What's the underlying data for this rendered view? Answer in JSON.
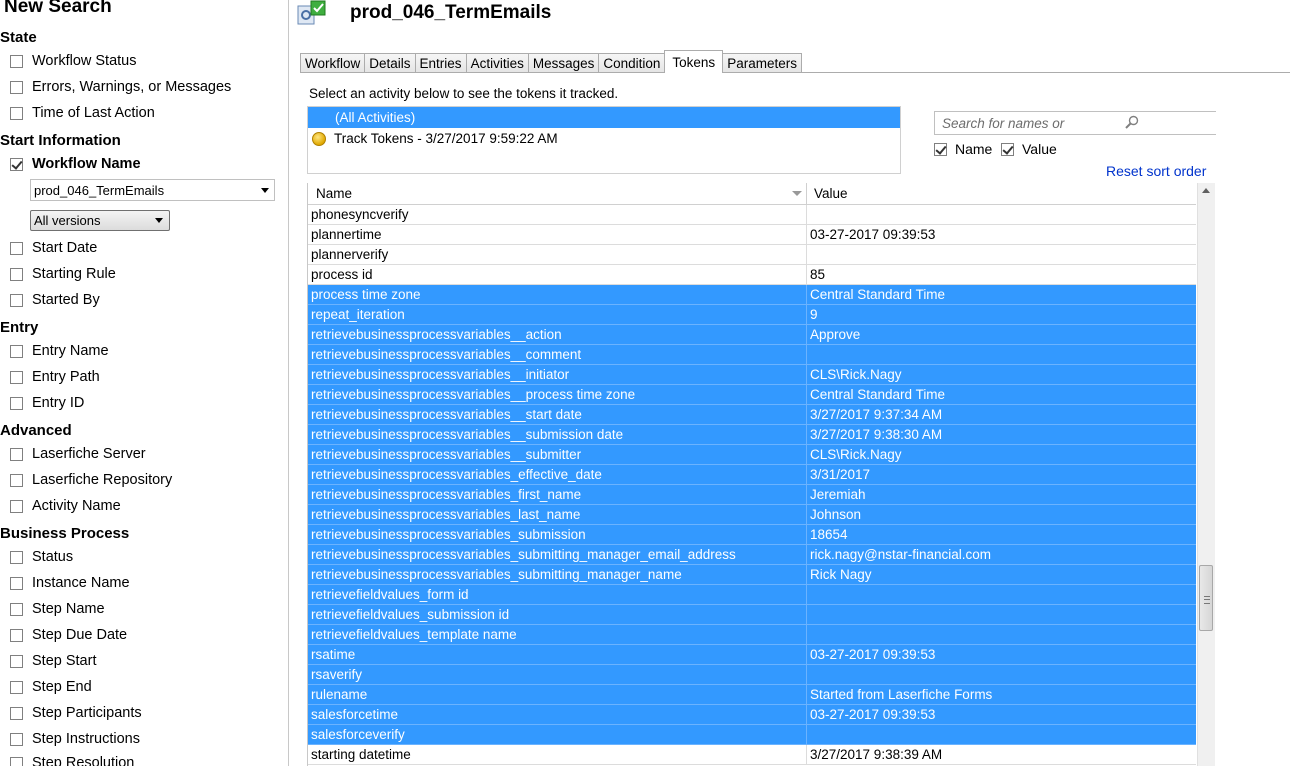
{
  "left_panel": {
    "title": "New Search",
    "sections": {
      "state": "State",
      "start_info": "Start Information",
      "entry": "Entry",
      "advanced": "Advanced",
      "business_process": "Business Process"
    },
    "options": {
      "workflow_status": "Workflow Status",
      "errors": "Errors, Warnings, or Messages",
      "time_last_action": "Time of Last Action",
      "workflow_name": "Workflow Name",
      "start_date": "Start Date",
      "starting_rule": "Starting Rule",
      "started_by": "Started By",
      "entry_name": "Entry Name",
      "entry_path": "Entry Path",
      "entry_id": "Entry ID",
      "lf_server": "Laserfiche Server",
      "lf_repository": "Laserfiche Repository",
      "activity_name": "Activity Name",
      "status": "Status",
      "instance_name": "Instance Name",
      "step_name": "Step Name",
      "step_due_date": "Step Due Date",
      "step_start": "Step Start",
      "step_end": "Step End",
      "step_participants": "Step Participants",
      "step_instructions": "Step Instructions",
      "step_resolution": "Step Resolution"
    },
    "workflow_name_value": "prod_046_TermEmails",
    "versions_value": "All versions"
  },
  "header": {
    "title": "prod_046_TermEmails"
  },
  "tabs": [
    "Workflow",
    "Details",
    "Entries",
    "Activities",
    "Messages",
    "Condition",
    "Tokens",
    "Parameters"
  ],
  "active_tab": "Tokens",
  "instruction": "Select an activity below to see the tokens it tracked.",
  "activities": [
    "(All Activities)",
    "Track Tokens - 3/27/2017 9:59:22 AM"
  ],
  "search": {
    "placeholder": "Search for names or"
  },
  "filters": {
    "name": "Name",
    "value": "Value"
  },
  "reset_sort": "Reset sort order",
  "grid": {
    "col_name": "Name",
    "col_value": "Value",
    "rows": [
      {
        "name": "phonesyncverify",
        "value": "",
        "selected": false
      },
      {
        "name": "plannertime",
        "value": "03-27-2017 09:39:53",
        "selected": false
      },
      {
        "name": "plannerverify",
        "value": "",
        "selected": false
      },
      {
        "name": "process id",
        "value": "85",
        "selected": false
      },
      {
        "name": "process time zone",
        "value": "Central Standard Time",
        "selected": true
      },
      {
        "name": "repeat_iteration",
        "value": "9",
        "selected": true
      },
      {
        "name": "retrievebusinessprocessvariables__action",
        "value": "Approve",
        "selected": true
      },
      {
        "name": "retrievebusinessprocessvariables__comment",
        "value": "",
        "selected": true
      },
      {
        "name": "retrievebusinessprocessvariables__initiator",
        "value": "CLS\\Rick.Nagy",
        "selected": true
      },
      {
        "name": "retrievebusinessprocessvariables__process time zone",
        "value": "Central Standard Time",
        "selected": true
      },
      {
        "name": "retrievebusinessprocessvariables__start date",
        "value": "3/27/2017 9:37:34 AM",
        "selected": true
      },
      {
        "name": "retrievebusinessprocessvariables__submission date",
        "value": "3/27/2017 9:38:30 AM",
        "selected": true
      },
      {
        "name": "retrievebusinessprocessvariables__submitter",
        "value": "CLS\\Rick.Nagy",
        "selected": true
      },
      {
        "name": "retrievebusinessprocessvariables_effective_date",
        "value": "3/31/2017",
        "selected": true
      },
      {
        "name": "retrievebusinessprocessvariables_first_name",
        "value": "Jeremiah",
        "selected": true
      },
      {
        "name": "retrievebusinessprocessvariables_last_name",
        "value": "Johnson",
        "selected": true
      },
      {
        "name": "retrievebusinessprocessvariables_submission",
        "value": "18654",
        "selected": true
      },
      {
        "name": "retrievebusinessprocessvariables_submitting_manager_email_address",
        "value": "rick.nagy@nstar-financial.com",
        "selected": true
      },
      {
        "name": "retrievebusinessprocessvariables_submitting_manager_name",
        "value": "Rick Nagy",
        "selected": true
      },
      {
        "name": "retrievefieldvalues_form id",
        "value": "",
        "selected": true
      },
      {
        "name": "retrievefieldvalues_submission id",
        "value": "",
        "selected": true
      },
      {
        "name": "retrievefieldvalues_template name",
        "value": "",
        "selected": true
      },
      {
        "name": "rsatime",
        "value": "03-27-2017 09:39:53",
        "selected": true
      },
      {
        "name": "rsaverify",
        "value": "",
        "selected": true
      },
      {
        "name": "rulename",
        "value": "Started from Laserfiche Forms",
        "selected": true
      },
      {
        "name": "salesforcetime",
        "value": "03-27-2017 09:39:53",
        "selected": true
      },
      {
        "name": "salesforceverify",
        "value": "",
        "selected": true
      },
      {
        "name": "starting datetime",
        "value": "3/27/2017 9:38:39 AM",
        "selected": false
      }
    ]
  }
}
